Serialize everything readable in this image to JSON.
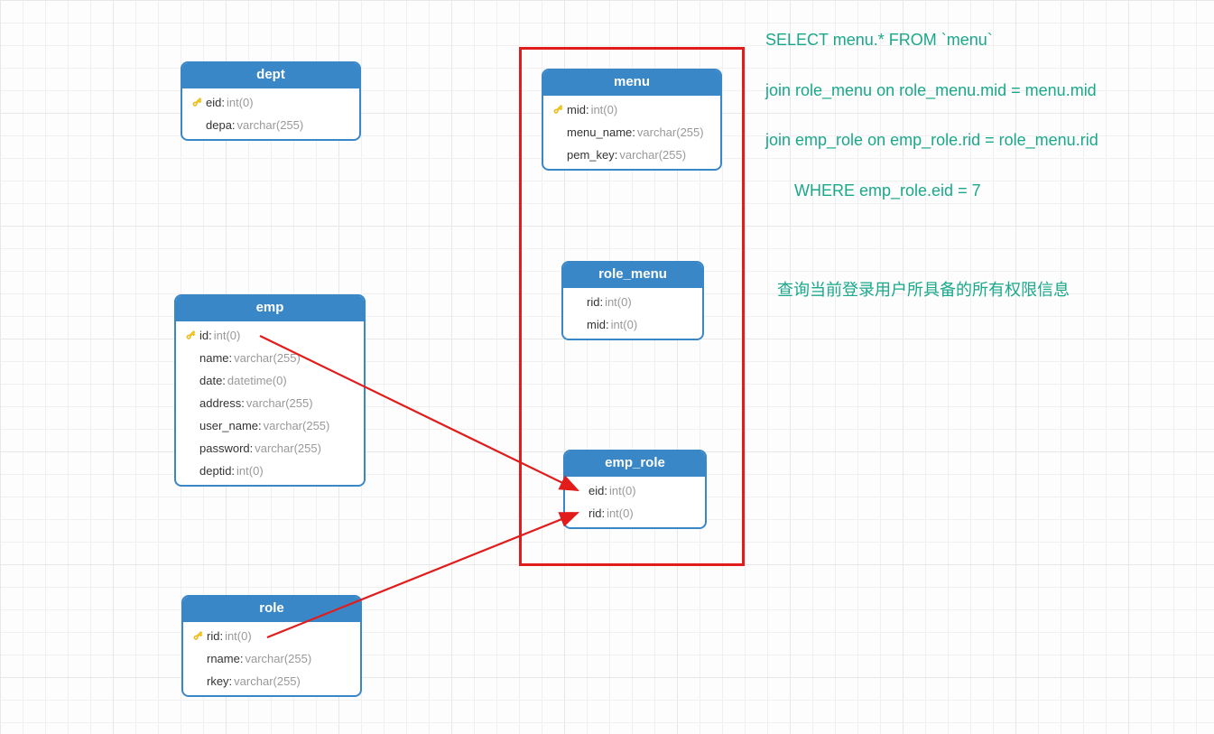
{
  "sql": {
    "line1": "SELECT menu.* FROM `menu`",
    "line2": "join role_menu on role_menu.mid = menu.mid",
    "line3": "join emp_role on emp_role.rid = role_menu.rid",
    "line4": "WHERE emp_role.eid = 7",
    "comment": "查询当前登录用户所具备的所有权限信息"
  },
  "entities": {
    "dept": {
      "title": "dept",
      "fields": [
        {
          "name": "eid",
          "type": "int(0)",
          "pk": true
        },
        {
          "name": "depa",
          "type": "varchar(255)",
          "pk": false
        }
      ]
    },
    "emp": {
      "title": "emp",
      "fields": [
        {
          "name": "id",
          "type": "int(0)",
          "pk": true
        },
        {
          "name": "name",
          "type": "varchar(255)",
          "pk": false
        },
        {
          "name": "date",
          "type": "datetime(0)",
          "pk": false
        },
        {
          "name": "address",
          "type": "varchar(255)",
          "pk": false
        },
        {
          "name": "user_name",
          "type": "varchar(255)",
          "pk": false
        },
        {
          "name": "password",
          "type": "varchar(255)",
          "pk": false
        },
        {
          "name": "deptid",
          "type": "int(0)",
          "pk": false
        }
      ]
    },
    "role": {
      "title": "role",
      "fields": [
        {
          "name": "rid",
          "type": "int(0)",
          "pk": true
        },
        {
          "name": "rname",
          "type": "varchar(255)",
          "pk": false
        },
        {
          "name": "rkey",
          "type": "varchar(255)",
          "pk": false
        }
      ]
    },
    "menu": {
      "title": "menu",
      "fields": [
        {
          "name": "mid",
          "type": "int(0)",
          "pk": true
        },
        {
          "name": "menu_name",
          "type": "varchar(255)",
          "pk": false
        },
        {
          "name": "pem_key",
          "type": "varchar(255)",
          "pk": false
        }
      ]
    },
    "role_menu": {
      "title": "role_menu",
      "fields": [
        {
          "name": "rid",
          "type": "int(0)",
          "pk": false
        },
        {
          "name": "mid",
          "type": "int(0)",
          "pk": false
        }
      ]
    },
    "emp_role": {
      "title": "emp_role",
      "fields": [
        {
          "name": "eid",
          "type": "int(0)",
          "pk": false
        },
        {
          "name": "rid",
          "type": "int(0)",
          "pk": false
        }
      ]
    }
  }
}
